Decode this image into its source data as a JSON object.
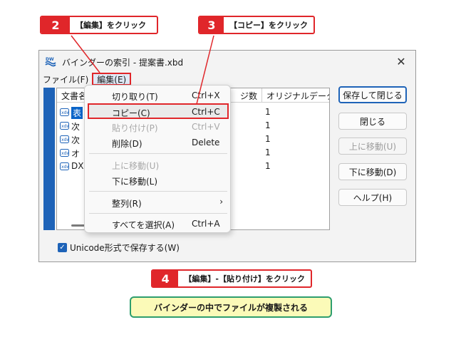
{
  "callouts": {
    "c2": {
      "num": "2",
      "text": "【編集】をクリック"
    },
    "c3": {
      "num": "3",
      "text": "【コピー】をクリック"
    },
    "c4": {
      "num": "4",
      "text": "【編集】-【貼り付け】をクリック"
    }
  },
  "window": {
    "title": "バインダーの索引 - 提案書.xbd",
    "icon": "dw-binder-icon",
    "close_label": "✕"
  },
  "menubar": {
    "file": "ファイル(F)",
    "edit": "編集(E)"
  },
  "list": {
    "columns": [
      "文書名",
      "ジ数",
      "オリジナルデータ数"
    ],
    "rows": [
      {
        "name": "表",
        "count": "1"
      },
      {
        "name": "次",
        "count": "1"
      },
      {
        "name": "次",
        "count": "1"
      },
      {
        "name": "オ",
        "count": "1"
      },
      {
        "name": "DX",
        "count": "1"
      }
    ]
  },
  "buttons": {
    "save_close": "保存して閉じる",
    "close": "閉じる",
    "move_up": "上に移動(U)",
    "move_down": "下に移動(D)",
    "help": "ヘルプ(H)"
  },
  "checkbox": {
    "label": "Unicode形式で保存する(W)",
    "checked": true
  },
  "edit_menu": {
    "cut": {
      "label": "切り取り(T)",
      "shortcut": "Ctrl+X"
    },
    "copy": {
      "label": "コピー(C)",
      "shortcut": "Ctrl+C"
    },
    "paste": {
      "label": "貼り付け(P)",
      "shortcut": "Ctrl+V"
    },
    "delete": {
      "label": "削除(D)",
      "shortcut": "Delete"
    },
    "move_up": {
      "label": "上に移動(U)"
    },
    "move_down": {
      "label": "下に移動(L)"
    },
    "sort": {
      "label": "整列(R)",
      "arrow": "›"
    },
    "select_all": {
      "label": "すべてを選択(A)",
      "shortcut": "Ctrl+A"
    }
  },
  "note": "バインダーの中でファイルが複製される",
  "colors": {
    "callout_red": "#e0262a",
    "note_green": "#2e9e6e",
    "note_bg": "#fbfab8",
    "accent_blue": "#1e63b8"
  }
}
